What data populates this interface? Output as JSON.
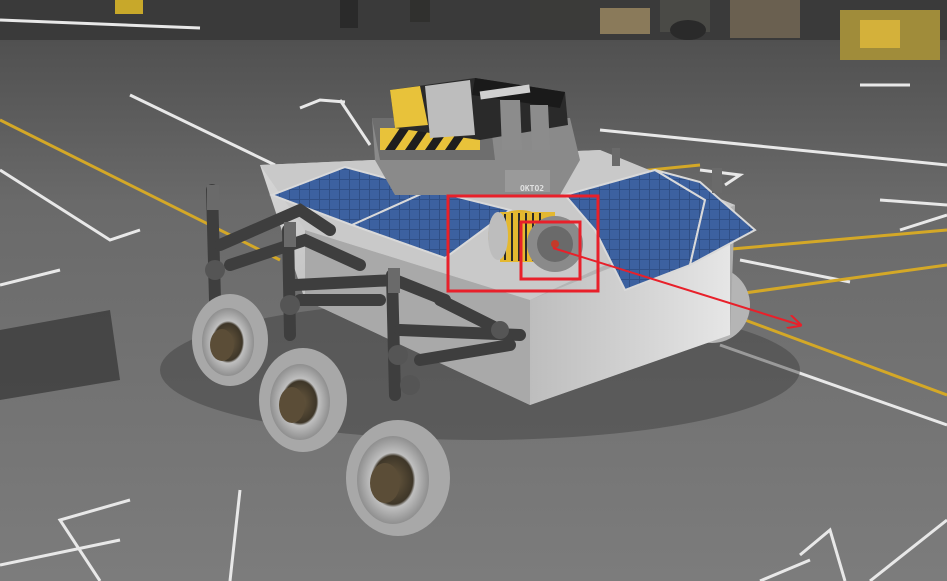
{
  "scene": {
    "setting": "vehicle-assembly-hangar",
    "rover": {
      "part_labels": {
        "battery_pack": "",
        "probe_core": "OKTO2"
      },
      "solar_panel_count": 4,
      "wheel_count": 6,
      "selected_part": "cylindrical-battery-on-rover-body"
    },
    "annotation": {
      "color": "#e8202a",
      "outer_box": "selected-part-highlight",
      "inner_box": "attachment-node-highlight",
      "arrow": "direction-pointer"
    }
  }
}
